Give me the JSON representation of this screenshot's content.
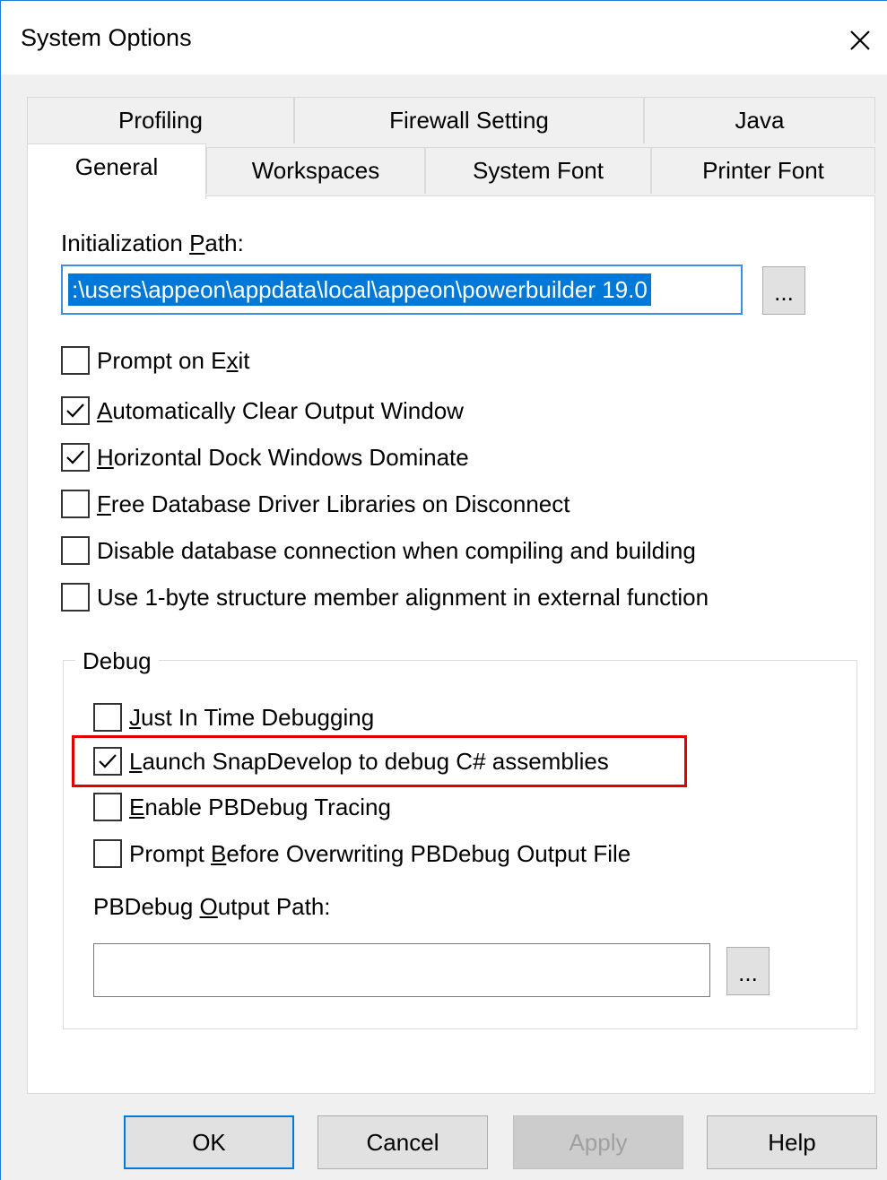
{
  "window": {
    "title": "System Options"
  },
  "tabs": {
    "row1": [
      "Profiling",
      "Firewall Setting",
      "Java"
    ],
    "row2": [
      "General",
      "Workspaces",
      "System Font",
      "Printer Font"
    ],
    "active": "General"
  },
  "general": {
    "init_path_label_pre": "Initialization ",
    "init_path_label_u": "P",
    "init_path_label_post": "ath:",
    "init_path_value": ":\\users\\appeon\\appdata\\local\\appeon\\powerbuilder 19.0",
    "browse_label": "...",
    "options": [
      {
        "pre": "Prompt on E",
        "u": "x",
        "post": "it",
        "checked": false
      },
      {
        "pre": "",
        "u": "A",
        "post": "utomatically Clear Output Window",
        "checked": true
      },
      {
        "pre": "",
        "u": "H",
        "post": "orizontal Dock Windows Dominate",
        "checked": true
      },
      {
        "pre": "",
        "u": "F",
        "post": "ree Database Driver Libraries on Disconnect",
        "checked": false
      },
      {
        "pre": "Disable database connection when compiling and building",
        "u": "",
        "post": "",
        "checked": false
      },
      {
        "pre": "Use 1-byte structure member alignment in external function",
        "u": "",
        "post": "",
        "checked": false
      }
    ]
  },
  "debug": {
    "group_label": "Debug",
    "options": [
      {
        "pre": "",
        "u": "J",
        "post": "ust In Time Debugging",
        "checked": false
      },
      {
        "pre": "",
        "u": "L",
        "post": "aunch SnapDevelop to debug C# assemblies",
        "checked": true
      },
      {
        "pre": "",
        "u": "E",
        "post": "nable PBDebug Tracing",
        "checked": false
      },
      {
        "pre": "Prompt ",
        "u": "B",
        "post": "efore Overwriting PBDebug Output File",
        "checked": false
      }
    ],
    "output_label_pre": "PBDebug ",
    "output_label_u": "O",
    "output_label_post": "utput Path:",
    "output_value": "",
    "browse_label": "..."
  },
  "buttons": {
    "ok": "OK",
    "cancel": "Cancel",
    "apply": "Apply",
    "help": "Help"
  },
  "colors": {
    "highlight_border": "#e00000",
    "selection": "#0078d7",
    "accent": "#1f7fd4"
  }
}
